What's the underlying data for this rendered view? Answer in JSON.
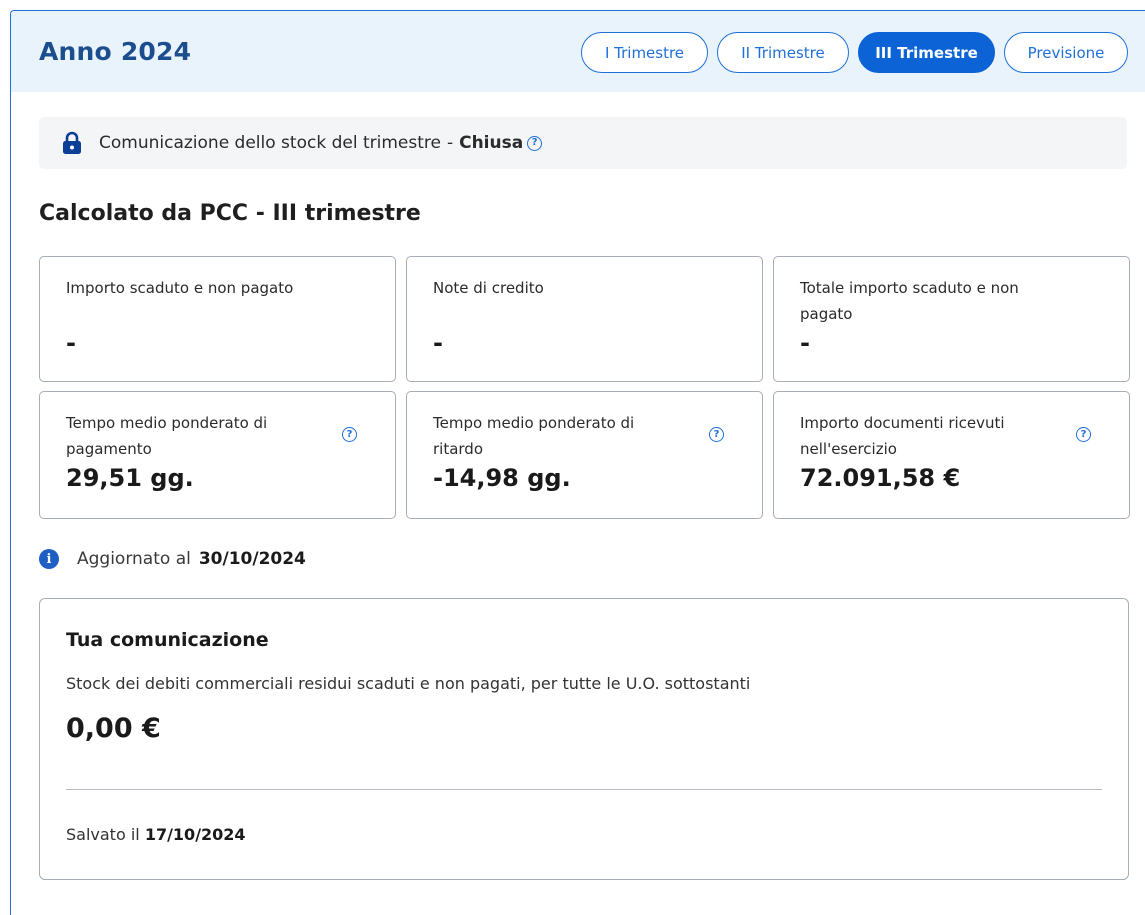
{
  "header": {
    "title": "Anno 2024",
    "tabs": [
      {
        "label": "I Trimestre",
        "active": false
      },
      {
        "label": "II Trimestre",
        "active": false
      },
      {
        "label": "III Trimestre",
        "active": true
      },
      {
        "label": "Previsione",
        "active": false
      }
    ]
  },
  "status": {
    "text": "Comunicazione dello stock del trimestre",
    "separator": "-",
    "state": "Chiusa",
    "icon": "lock-icon"
  },
  "section": {
    "title": "Calcolato da PCC - III trimestre"
  },
  "cards": [
    {
      "label": "Importo scaduto e non pagato",
      "value": "-"
    },
    {
      "label": "Note di credito",
      "value": "-"
    },
    {
      "label": "Totale importo scaduto e non pagato",
      "value": "-"
    },
    {
      "label": "Tempo medio ponderato di pagamento",
      "value": "29,51 gg."
    },
    {
      "label": "Tempo medio ponderato di ritardo",
      "value": "-14,98 gg."
    },
    {
      "label": "Importo documenti ricevuti nell'esercizio",
      "value": "72.091,58 €"
    }
  ],
  "updated": {
    "label": "Aggiornato al",
    "date": "30/10/2024"
  },
  "communication": {
    "title": "Tua comunicazione",
    "description": "Stock dei debiti commerciali residui scaduti e non pagati, per tutte le U.O. sottostanti",
    "value": "0,00 €",
    "saved_label": "Salvato il",
    "saved_date": "17/10/2024"
  },
  "colors": {
    "accent": "#1f6fd8",
    "header_bg": "#e8f3fc",
    "title": "#1b4d8f"
  }
}
